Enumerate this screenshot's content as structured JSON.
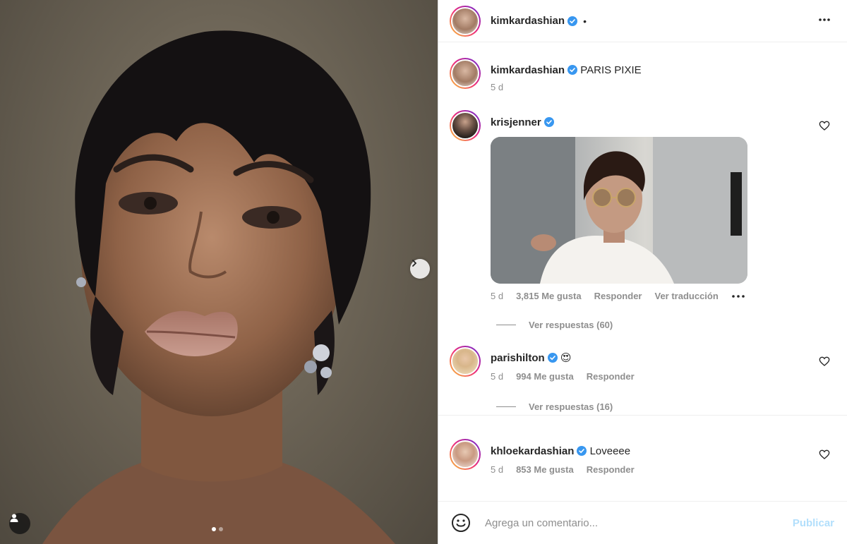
{
  "post": {
    "author": "kimkardashian",
    "caption": "PARIS PIXIE",
    "time": "5 d",
    "header_dot": "•",
    "carousel": {
      "count": 2,
      "active": 0
    }
  },
  "comments": [
    {
      "username": "krisjenner",
      "text": "",
      "time": "5 d",
      "likes": "3,815 Me gusta",
      "reply_label": "Responder",
      "translate_label": "Ver traducción",
      "has_gif": true,
      "replies_label": "Ver respuestas (60)"
    },
    {
      "username": "parishilton",
      "text": "😍",
      "time": "5 d",
      "likes": "994 Me gusta",
      "reply_label": "Responder",
      "replies_label": "Ver respuestas (16)"
    },
    {
      "username": "khloekardashian",
      "text": "Loveeee",
      "time": "5 d",
      "likes": "853 Me gusta",
      "reply_label": "Responder"
    }
  ],
  "composer": {
    "placeholder": "Agrega un comentario...",
    "publish_label": "Publicar"
  },
  "colors": {
    "verified": "#3897f0",
    "meta_text": "#8e8e8e",
    "publish_disabled": "#b2dffc"
  },
  "icons": [
    "chevron-right-icon",
    "user-tag-icon",
    "verified-icon",
    "more-icon",
    "heart-icon",
    "emoji-icon"
  ]
}
